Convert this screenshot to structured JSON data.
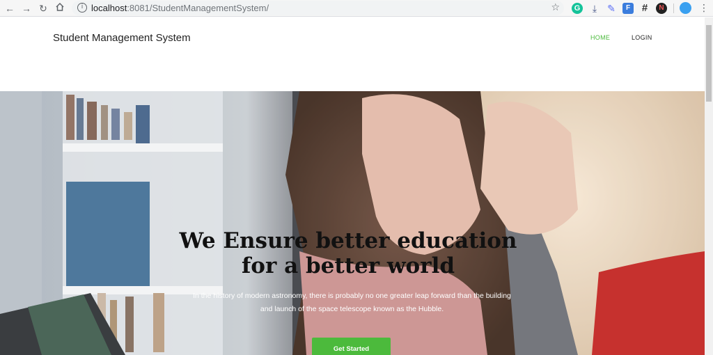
{
  "browser": {
    "url_host": "localhost",
    "url_path": ":8081/StudentManagementSystem/"
  },
  "header": {
    "brand": "Student Management System",
    "nav": {
      "home": "HOME",
      "login": "LOGIN"
    }
  },
  "hero": {
    "title_line1": "We Ensure better education",
    "title_line2": "for a better world",
    "text_line1": "In the history of modern astronomy, there is probably no one greater leap forward than the building",
    "text_line2": "and launch of the space telescope known as the Hubble.",
    "cta_label": "Get Started"
  },
  "colors": {
    "accent": "#4cba3c"
  }
}
